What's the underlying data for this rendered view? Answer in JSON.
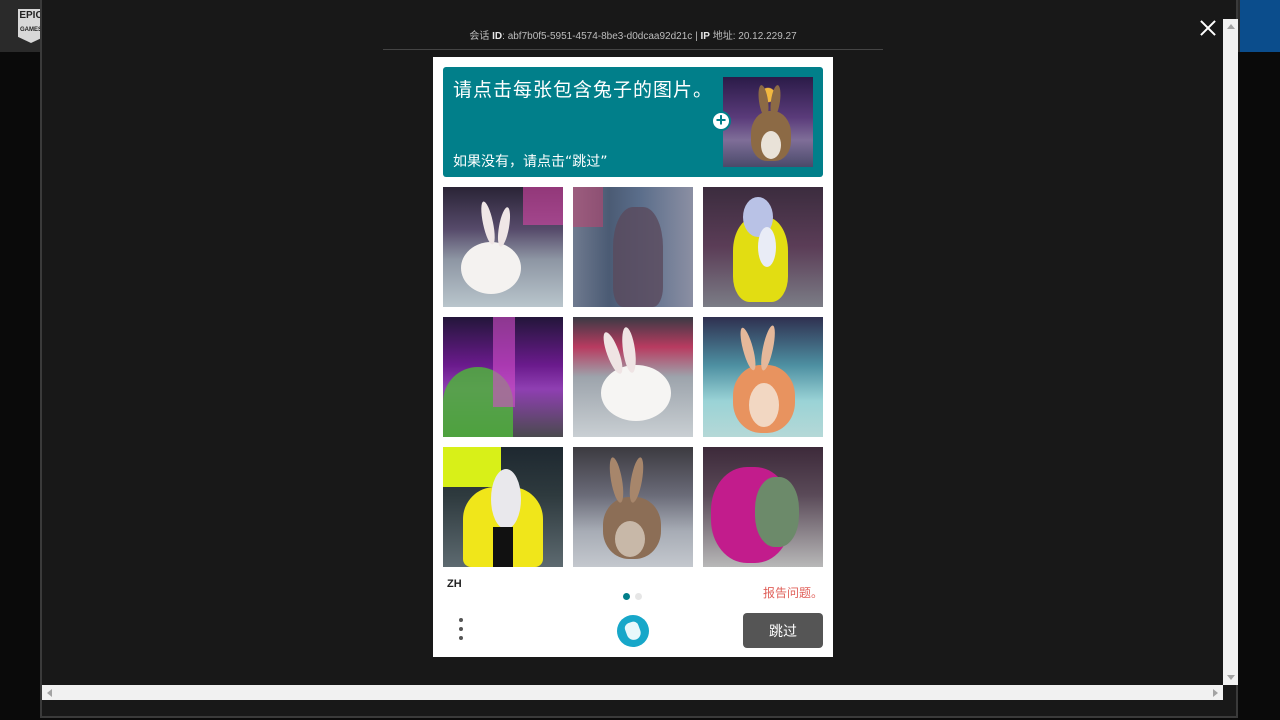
{
  "background": {
    "logo_text": "EPIC",
    "logo_sub": "GAMES"
  },
  "session": {
    "prefix": "会话",
    "id_label": "ID",
    "id_value": "abf7b0f5-5951-4574-8be3-d0dcaa92d21c",
    "separator": "|",
    "ip_label": "IP",
    "ip_suffix": "地址",
    "ip_value": "20.12.229.27"
  },
  "captcha": {
    "prompt_title": "请点击每张包含兔子的图片。",
    "prompt_sub": "如果没有，请点击“跳过”",
    "example_icon": "rabbit-example",
    "add_icon": "plus-circle-icon",
    "language": "ZH",
    "report_label": "报告问题。",
    "submit_label": "跳过",
    "accent": "#017f8a",
    "report_color": "#e0605a",
    "submit_color": "#555555",
    "page_dots": [
      {
        "active": true
      },
      {
        "active": false
      }
    ],
    "tiles": [
      {
        "subject": "white rabbit"
      },
      {
        "subject": "blurred animal"
      },
      {
        "subject": "yellow fox"
      },
      {
        "subject": "green bird"
      },
      {
        "subject": "white rabbit"
      },
      {
        "subject": "orange rabbit"
      },
      {
        "subject": "yellow creature"
      },
      {
        "subject": "brown rabbit"
      },
      {
        "subject": "magenta creature"
      }
    ]
  }
}
